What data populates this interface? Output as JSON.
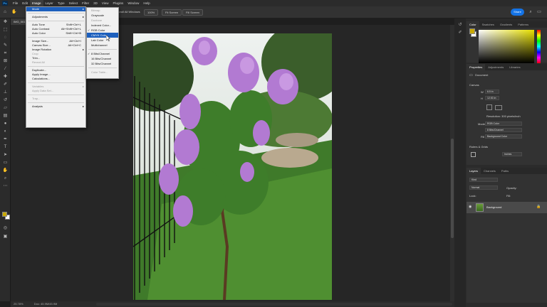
{
  "menubar": {
    "app_icon": "Ps",
    "items": [
      "File",
      "Edit",
      "Image",
      "Layer",
      "Type",
      "Select",
      "Filter",
      "3D",
      "View",
      "Plugins",
      "Window",
      "Help"
    ]
  },
  "options": {
    "scroll_all": "Scroll All Windows",
    "zoom": "100%",
    "fit_screen": "Fit Screen",
    "fill_screen": "Fill Screen",
    "share": "Share"
  },
  "document": {
    "tab": "IMG_0017.jpg @ 25.7%",
    "status_zoom": "25.78%",
    "status_doc": "Doc: 45.9M/45.9M"
  },
  "image_menu": {
    "items": [
      {
        "label": "Mode",
        "shortcut": "",
        "submenu": true,
        "state": "highlight"
      },
      {
        "sep": true
      },
      {
        "label": "Adjustments",
        "shortcut": "",
        "submenu": true
      },
      {
        "sep": true
      },
      {
        "label": "Auto Tone",
        "shortcut": "Shift+Ctrl+L"
      },
      {
        "label": "Auto Contrast",
        "shortcut": "Alt+Shift+Ctrl+L"
      },
      {
        "label": "Auto Color",
        "shortcut": "Shift+Ctrl+B"
      },
      {
        "sep": true
      },
      {
        "label": "Image Size...",
        "shortcut": "Alt+Ctrl+I"
      },
      {
        "label": "Canvas Size...",
        "shortcut": "Alt+Ctrl+C"
      },
      {
        "label": "Image Rotation",
        "shortcut": "",
        "submenu": true
      },
      {
        "label": "Crop",
        "shortcut": "",
        "state": "disabled"
      },
      {
        "label": "Trim...",
        "shortcut": ""
      },
      {
        "label": "Reveal All",
        "shortcut": "",
        "state": "disabled"
      },
      {
        "sep": true
      },
      {
        "label": "Duplicate...",
        "shortcut": ""
      },
      {
        "label": "Apply Image...",
        "shortcut": ""
      },
      {
        "label": "Calculations...",
        "shortcut": ""
      },
      {
        "sep": true
      },
      {
        "label": "Variables",
        "shortcut": "",
        "submenu": true,
        "state": "disabled"
      },
      {
        "label": "Apply Data Set...",
        "shortcut": "",
        "state": "disabled"
      },
      {
        "sep": true
      },
      {
        "label": "Trap...",
        "shortcut": "",
        "state": "disabled"
      },
      {
        "sep": true
      },
      {
        "label": "Analysis",
        "shortcut": "",
        "submenu": true
      }
    ]
  },
  "mode_menu": {
    "items": [
      {
        "label": "Bitmap",
        "state": "disabled"
      },
      {
        "label": "Grayscale"
      },
      {
        "label": "Duotone",
        "state": "disabled"
      },
      {
        "label": "Indexed Color..."
      },
      {
        "label": "RGB Color",
        "checked": true
      },
      {
        "label": "CMYK Color",
        "state": "highlight"
      },
      {
        "label": "Lab Color"
      },
      {
        "label": "Multichannel"
      },
      {
        "sep": true
      },
      {
        "label": "8 Bits/Channel",
        "checked": true
      },
      {
        "label": "16 Bits/Channel"
      },
      {
        "label": "32 Bits/Channel"
      },
      {
        "sep": true
      },
      {
        "label": "Color Table...",
        "state": "disabled"
      }
    ]
  },
  "panels": {
    "color_tabs": [
      "Color",
      "Swatches",
      "Gradients",
      "Patterns"
    ],
    "prop_tabs": [
      "Properties",
      "Adjustments",
      "Libraries"
    ],
    "doc_label": "Document",
    "canvas_title": "Canvas",
    "w_label": "W",
    "w_value": "6.5 in",
    "h_label": "H",
    "h_value": "12.53 in",
    "resolution": "Resolution: 300 pixels/inch",
    "mode_label": "Mode",
    "mode_value": "RGB Color",
    "bits_value": "8 Bits/Channel",
    "fill_label": "Fill",
    "fill_value": "Background Color",
    "rulers_title": "Rulers & Grids",
    "units_value": "Inches",
    "layers_tabs": [
      "Layers",
      "Channels",
      "Paths"
    ],
    "layer_kind": "Kind",
    "blend_mode": "Normal",
    "opacity_label": "Opacity:",
    "lock_label": "Lock:",
    "fill2_label": "Fill:",
    "layer_name": "Background"
  }
}
